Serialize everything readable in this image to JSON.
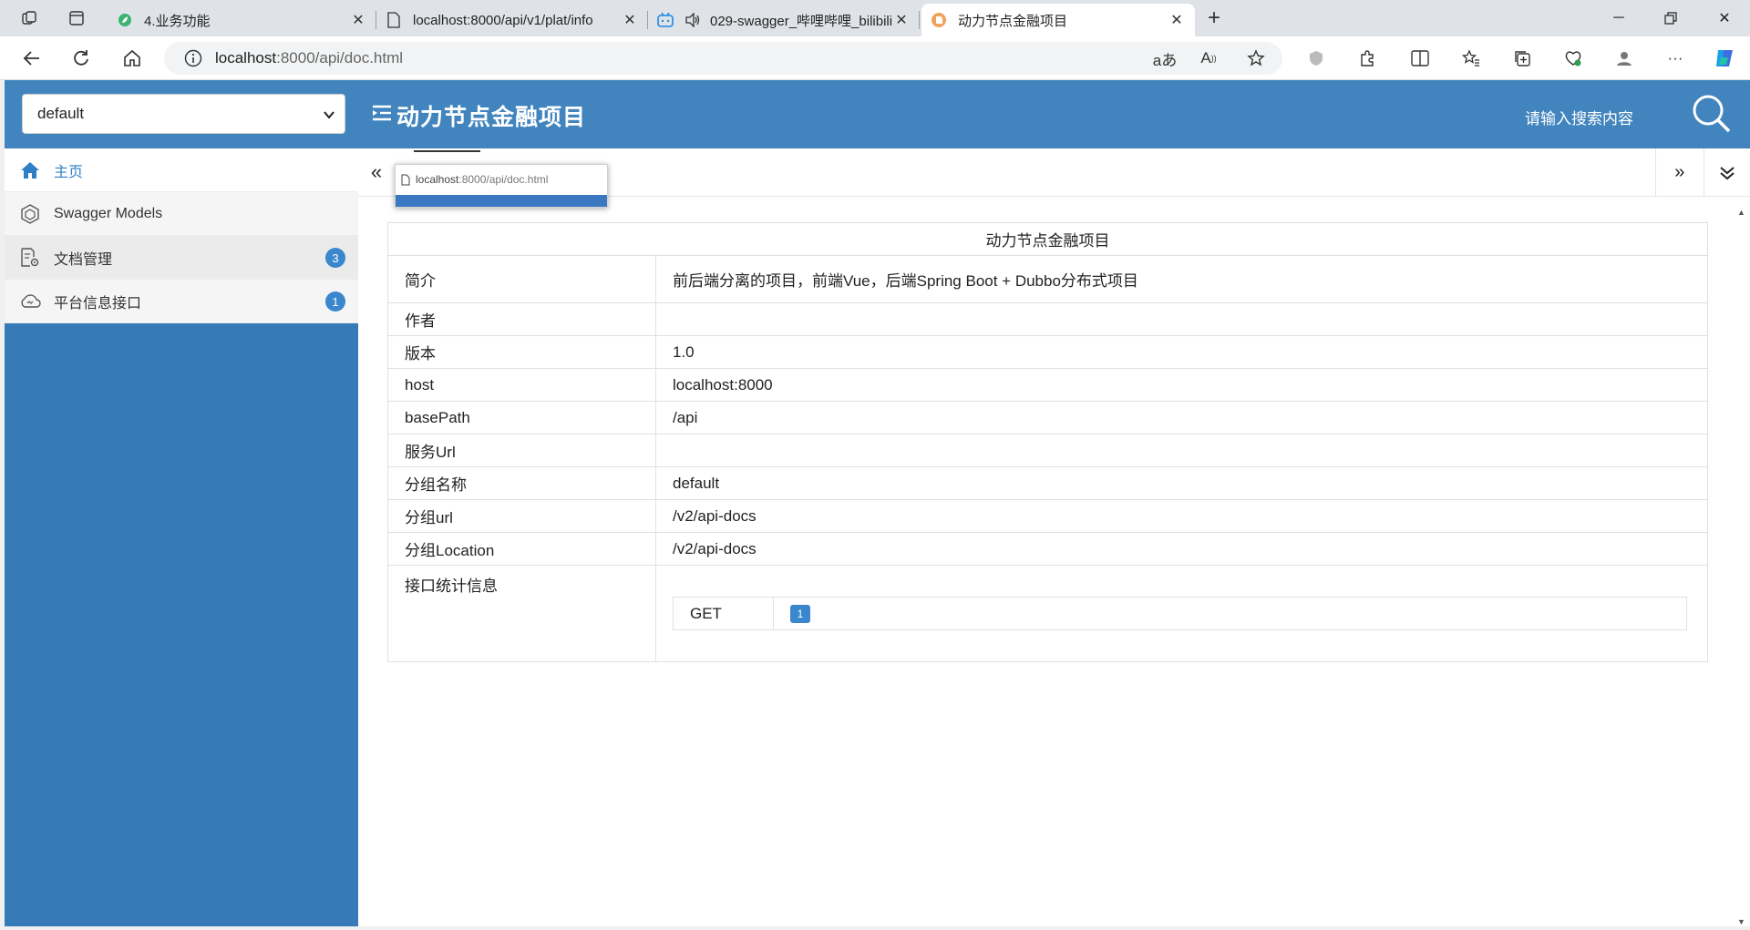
{
  "browser": {
    "tabs": [
      {
        "title": "4.业务功能",
        "icon": "green-leaf-icon"
      },
      {
        "title": "localhost:8000/api/v1/plat/info",
        "icon": "page-icon"
      },
      {
        "title": "029-swagger_哔哩哔哩_bilibili",
        "icon": "bilibili-icon"
      },
      {
        "title": "动力节点金融项目",
        "icon": "swagger-favicon-icon"
      }
    ],
    "new_tab_label": "+",
    "address": {
      "host": "localhost",
      "rest": ":8000/api/doc.html"
    }
  },
  "header": {
    "group_select": "default",
    "title": "动力节点金融项目",
    "search_placeholder": "请输入搜索内容"
  },
  "sidebar": {
    "items": [
      {
        "label": "主页",
        "icon": "home-icon",
        "badge": ""
      },
      {
        "label": "Swagger Models",
        "icon": "models-icon",
        "badge": ""
      },
      {
        "label": "文档管理",
        "icon": "doc-settings-icon",
        "badge": "3"
      },
      {
        "label": "平台信息接口",
        "icon": "cloud-icon",
        "badge": "1"
      }
    ]
  },
  "tooltip": {
    "host": "localhost",
    "rest": ":8000/api/doc.html"
  },
  "info": {
    "title": "动力节点金融项目",
    "rows": [
      {
        "key": "简介",
        "value": "前后端分离的项目，前端Vue，后端Spring Boot + Dubbo分布式项目"
      },
      {
        "key": "作者",
        "value": ""
      },
      {
        "key": "版本",
        "value": "1.0"
      },
      {
        "key": "host",
        "value": "localhost:8000"
      },
      {
        "key": "basePath",
        "value": "/api"
      },
      {
        "key": "服务Url",
        "value": ""
      },
      {
        "key": "分组名称",
        "value": "default"
      },
      {
        "key": "分组url",
        "value": "/v2/api-docs"
      },
      {
        "key": "分组Location",
        "value": "/v2/api-docs"
      }
    ],
    "stats_label": "接口统计信息",
    "stats": [
      {
        "method": "GET",
        "count": "1"
      }
    ]
  },
  "colors": {
    "header": "#4285be",
    "sidebar": "#367ab8",
    "accent": "#3a87ce"
  }
}
